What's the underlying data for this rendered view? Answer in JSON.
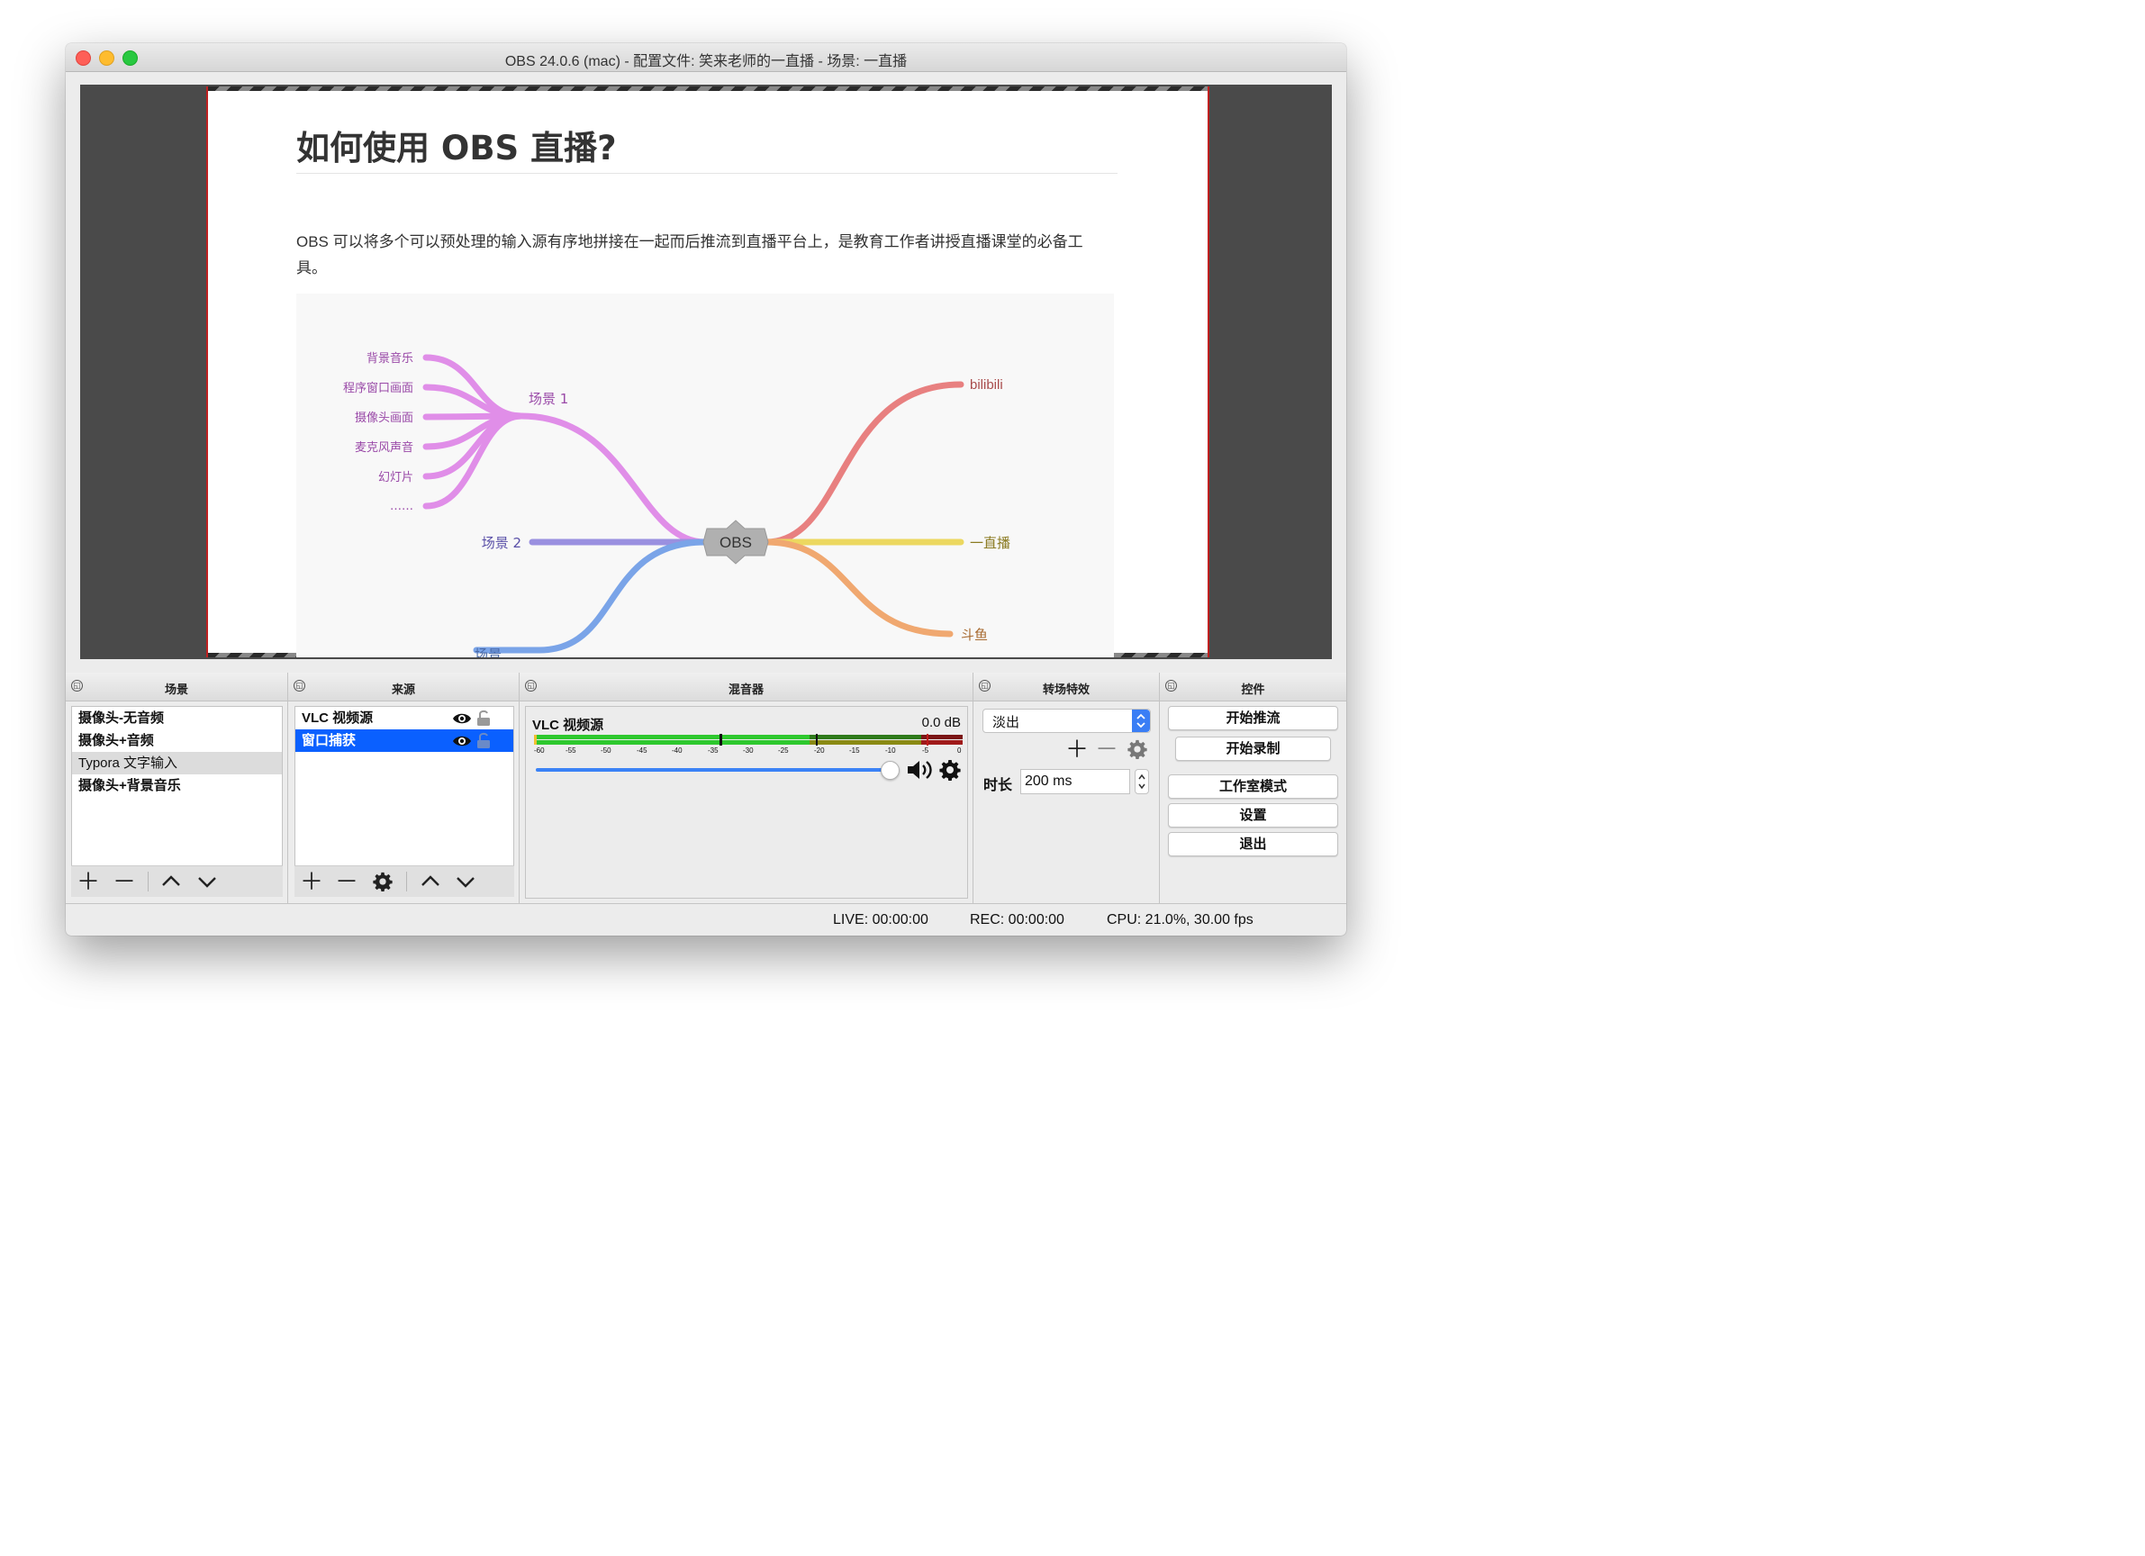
{
  "window": {
    "title": "OBS 24.0.6 (mac) - 配置文件: 笑来老师的一直播 - 场景: 一直播"
  },
  "preview": {
    "doc_title": "如何使用 OBS 直播?",
    "doc_paragraph": "OBS 可以将多个可以预处理的输入源有序地拼接在一起而后推流到直播平台上，是教育工作者讲授直播课堂的必备工具。",
    "mindmap": {
      "center": "OBS",
      "scene1": "场景 1",
      "scene1_items": [
        "背景音乐",
        "程序窗口画面",
        "摄像头画面",
        "麦克风声音",
        "幻灯片",
        "……"
      ],
      "scene2": "场景 2",
      "scene3_partial": "场景",
      "platforms": [
        "bilibili",
        "一直播",
        "斗鱼"
      ],
      "colors": {
        "scene1": "#e08ee8",
        "scene2": "#9a90e0",
        "scene3": "#7aa4e8",
        "bilibili": "#e88080",
        "yizhibo": "#ecd860",
        "douyu": "#f0a870"
      }
    }
  },
  "docks": {
    "scenes": {
      "title": "场景",
      "items": [
        "摄像头-无音频",
        "摄像头+音频",
        "Typora 文字输入",
        "摄像头+背景音乐"
      ],
      "selected_index": 2
    },
    "sources": {
      "title": "来源",
      "items": [
        "VLC 视频源",
        "窗口捕获"
      ],
      "selected_index": 1
    },
    "mixer": {
      "title": "混音器",
      "channel": "VLC 视频源",
      "level": "0.0 dB",
      "scale": [
        "-60",
        "-55",
        "-50",
        "-45",
        "-40",
        "-35",
        "-30",
        "-25",
        "-20",
        "-15",
        "-10",
        "-5",
        "0"
      ],
      "volume_fraction": 1.0
    },
    "transitions": {
      "title": "转场特效",
      "selected": "淡出",
      "duration_label": "时长",
      "duration_value": "200 ms"
    },
    "controls": {
      "title": "控件",
      "buttons": [
        "开始推流",
        "开始录制",
        "工作室模式",
        "设置",
        "退出"
      ]
    }
  },
  "status": {
    "live": "LIVE: 00:00:00",
    "rec": "REC: 00:00:00",
    "cpu": "CPU: 21.0%, 30.00 fps"
  }
}
